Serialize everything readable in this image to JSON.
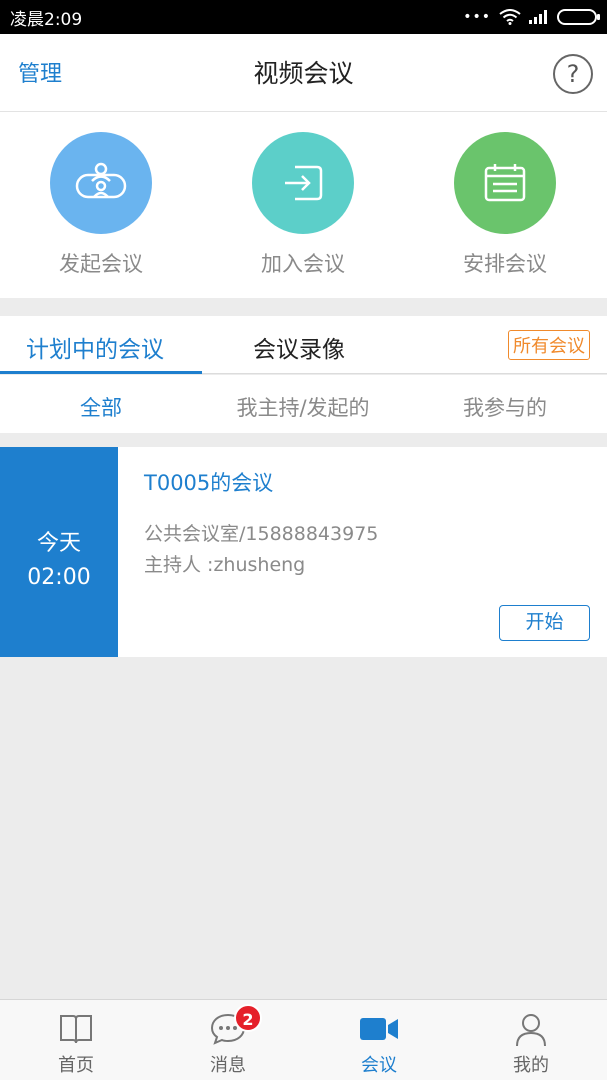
{
  "status_bar": {
    "time": "凌晨2:09",
    "dots": "•••"
  },
  "header": {
    "left_label": "管理",
    "title": "视频会议",
    "help": "?"
  },
  "actions": [
    {
      "label": "发起会议",
      "icon": "start-meeting-icon",
      "color": "#6ab4ef"
    },
    {
      "label": "加入会议",
      "icon": "join-meeting-icon",
      "color": "#5ccfc9"
    },
    {
      "label": "安排会议",
      "icon": "schedule-meeting-icon",
      "color": "#6ac46c"
    }
  ],
  "tabs": {
    "planned": "计划中的会议",
    "recordings": "会议录像",
    "all_meetings": "所有会议"
  },
  "filters": {
    "all": "全部",
    "hosted": "我主持/发起的",
    "joined": "我参与的"
  },
  "meeting": {
    "day": "今天",
    "time": "02:00",
    "title": "T0005的会议",
    "room": "公共会议室/15888843975",
    "host": "主持人 :zhusheng",
    "start_label": "开始"
  },
  "bottom_nav": [
    {
      "label": "首页",
      "icon": "book-icon"
    },
    {
      "label": "消息",
      "icon": "chat-icon",
      "badge": "2"
    },
    {
      "label": "会议",
      "icon": "video-camera-icon",
      "active": true
    },
    {
      "label": "我的",
      "icon": "person-icon"
    }
  ],
  "colors": {
    "accent": "#1e7fce",
    "orange": "#f08a2c",
    "badge": "#e5202a"
  }
}
